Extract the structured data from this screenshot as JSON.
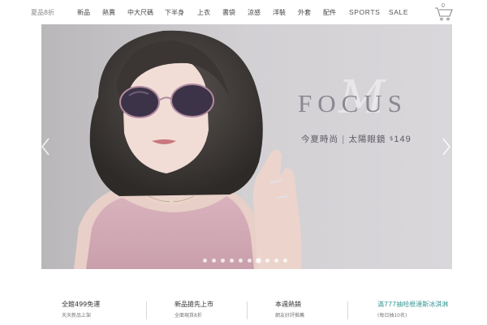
{
  "nav": {
    "items": [
      {
        "label": "夏品8折",
        "active": true
      },
      {
        "label": "新品"
      },
      {
        "label": "熱賣"
      },
      {
        "label": "中大尺碼"
      },
      {
        "label": "下半身"
      },
      {
        "label": "上衣"
      },
      {
        "label": "書袋"
      },
      {
        "label": "涼感"
      },
      {
        "label": "洋裝"
      },
      {
        "label": "外套"
      },
      {
        "label": "配件"
      },
      {
        "label": "SPORTS"
      },
      {
        "label": "SALE"
      }
    ],
    "cart_count": "0",
    "cart_icon": "shopping-cart-icon"
  },
  "hero": {
    "title": "FOCUS",
    "script_mark": "M",
    "tagline": "今夏時尚",
    "tagline_separator": "|",
    "tagline_product": "太陽眼鏡",
    "price_currency": "$",
    "price": "149",
    "slide_count": 10,
    "active_slide": 7,
    "left_arrow_icon": "chevron-left-icon",
    "right_arrow_icon": "chevron-right-icon"
  },
  "promos": [
    {
      "title": "全館499免運",
      "subtitle": "天天新品上架"
    },
    {
      "title": "新品搶先上市",
      "subtitle": "全面現貨8折"
    },
    {
      "title": "本週熱銷",
      "subtitle": "網友好評推薦"
    },
    {
      "title": "滿777抽哈根達斯冰淇淋",
      "subtitle": "(每日抽10名)"
    }
  ],
  "colors": {
    "accent_teal": "#3a9a95",
    "hero_background": "#c9c7c9",
    "title_gray": "#8b8792"
  }
}
